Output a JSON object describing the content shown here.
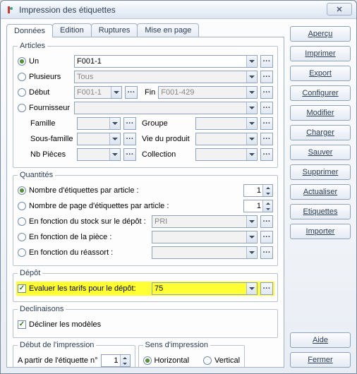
{
  "window": {
    "title": "Impression des étiquettes"
  },
  "tabs": [
    "Données",
    "Edition",
    "Ruptures",
    "Mise en page"
  ],
  "articles": {
    "legend": "Articles",
    "un_label": "Un",
    "un_value": "F001-1",
    "plusieurs_label": "Plusieurs",
    "plusieurs_value": "Tous",
    "debut_label": "Début",
    "debut_value": "F001-1",
    "fin_label": "Fin",
    "fin_value": "F001-429",
    "fournisseur_label": "Fournisseur",
    "famille_label": "Famille",
    "groupe_label": "Groupe",
    "sousfamille_label": "Sous-famille",
    "vie_label": "Vie du produit",
    "nbpieces_label": "Nb Pièces",
    "collection_label": "Collection"
  },
  "quantites": {
    "legend": "Quantités",
    "opt1_label": "Nombre d'étiquettes par article :",
    "opt1_value": "1",
    "opt2_label": "Nombre de page d'étiquettes par article :",
    "opt2_value": "1",
    "opt3_label": "En fonction du stock sur le dépôt :",
    "opt3_value": "PRI",
    "opt4_label": "En fonction de la pièce :",
    "opt5_label": "En fonction du réassort :"
  },
  "depot": {
    "legend": "Dépôt",
    "eval_label": "Evaluer les tarifs pour le dépôt:",
    "eval_value": "75"
  },
  "declinaisons": {
    "legend": "Declinaisons",
    "decl_label": "Décliner les modèles"
  },
  "debut_impression": {
    "legend": "Début de l'impression",
    "apartir_label": "A partir de l'étiquette n°",
    "apartir_value": "1"
  },
  "sens": {
    "legend": "Sens d'impression",
    "horiz_label": "Horizontal",
    "vert_label": "Vertical"
  },
  "sidebar": {
    "apercu": "Aperçu",
    "imprimer": "Imprimer",
    "export": "Export",
    "configurer": "Configurer",
    "modifier": "Modifier",
    "charger": "Charger",
    "sauver": "Sauver",
    "supprimer": "Supprimer",
    "actualiser": "Actualiser",
    "etiquettes": "Etiquettes",
    "importer": "Importer",
    "aide": "Aide",
    "fermer": "Fermer"
  }
}
